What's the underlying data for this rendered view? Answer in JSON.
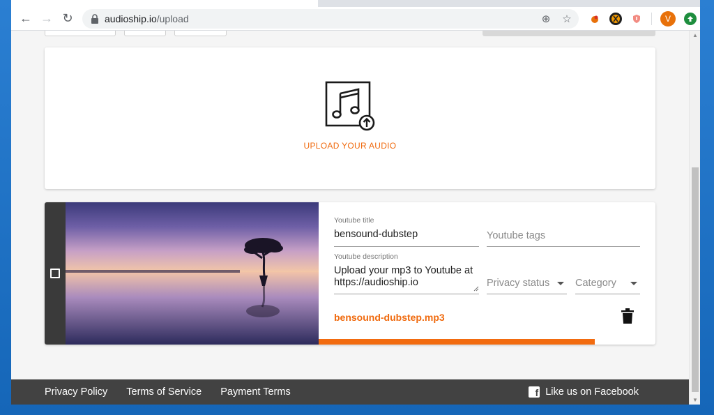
{
  "browser": {
    "url_domain": "audioship.io",
    "url_path": "/upload",
    "back_glyph": "←",
    "forward_glyph": "→",
    "reload_glyph": "↻",
    "zoom_glyph": "⊕",
    "star_glyph": "☆",
    "avatar_letter": "V",
    "icons": [
      "back-arrow-icon",
      "forward-arrow-icon",
      "reload-icon",
      "lock-icon",
      "zoom-icon",
      "bookmark-star-icon",
      "extension-icon",
      "profile-avatar",
      "update-icon"
    ]
  },
  "upload": {
    "label": "UPLOAD YOUR AUDIO",
    "icon": "music-upload-icon"
  },
  "track": {
    "title_label": "Youtube title",
    "title_value": "bensound-dubstep",
    "tags_placeholder": "Youtube tags",
    "description_label": "Youtube description",
    "description_value": "Upload your mp3 to Youtube at https://audioship.io",
    "privacy_placeholder": "Privacy status",
    "category_placeholder": "Category",
    "filename": "bensound-dubstep.mp3",
    "progress_fraction": 0.82
  },
  "footer": {
    "links": [
      "Privacy Policy",
      "Terms of Service",
      "Payment Terms"
    ],
    "facebook": "Like us on Facebook"
  },
  "colors": {
    "accent": "#f06a0e",
    "footer_bg": "#424242"
  }
}
